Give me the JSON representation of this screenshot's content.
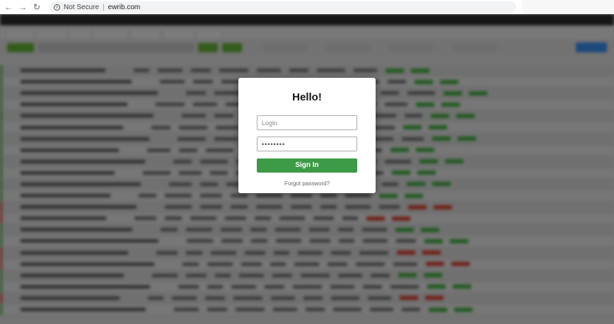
{
  "browser": {
    "security_label": "Not Secure",
    "separator": "|",
    "url": "ewrib.com",
    "back_glyph": "←",
    "forward_glyph": "→",
    "reload_glyph": "↻",
    "info_glyph": "i"
  },
  "modal": {
    "title": "Hello!",
    "login_placeholder": "Login",
    "password_value": "••••••••",
    "signin_label": "Sign In",
    "forgot_label": "Forgot password?"
  },
  "colors": {
    "signin_button": "#3d9a46",
    "positive": "#3a9a3a",
    "negative": "#c0392b",
    "accent_blue": "#2f7fd6"
  }
}
